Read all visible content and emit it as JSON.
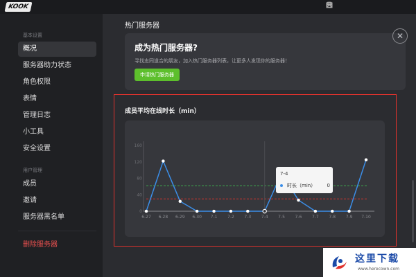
{
  "app": {
    "logo": "KOOK"
  },
  "sidebar": {
    "group1": "基本设置",
    "items1": [
      {
        "label": "概况",
        "active": true
      },
      {
        "label": "服务器助力状态"
      },
      {
        "label": "角色权限"
      },
      {
        "label": "表情"
      },
      {
        "label": "管理日志"
      },
      {
        "label": "小工具"
      },
      {
        "label": "安全设置"
      }
    ],
    "group2": "用户管理",
    "items2": [
      {
        "label": "成员"
      },
      {
        "label": "邀请"
      },
      {
        "label": "服务器黑名单"
      }
    ],
    "delete": "删除服务器"
  },
  "hot": {
    "section_title": "热门服务器",
    "title": "成为热门服务器?",
    "desc": "寻找志同道合的朋友，加入热门服务器列表，让更多人发现你的服务器！",
    "button": "申请热门服务器"
  },
  "chart_data": {
    "type": "line",
    "title": "成员平均在线时长（min）",
    "categories": [
      "6-27",
      "6-28",
      "6-29",
      "6-30",
      "7-1",
      "7-2",
      "7-3",
      "7-4",
      "7-5",
      "7-6",
      "7-7",
      "7-8",
      "7-9",
      "7-10"
    ],
    "series": [
      {
        "name": "时长（min）",
        "values": [
          0,
          122,
          24,
          0,
          0,
          0,
          0,
          0,
          92,
          27,
          0,
          0,
          0,
          125
        ],
        "color": "#3b8ee8"
      }
    ],
    "y_ticks": [
      0,
      40,
      80,
      120,
      160
    ],
    "ylim": [
      0,
      160
    ],
    "reference_lines": [
      {
        "value": 62,
        "color": "#3fb950"
      },
      {
        "value": 30,
        "color": "#e0322d"
      }
    ],
    "tooltip": {
      "date": "7-4",
      "label": "时长（min）",
      "value": "0"
    },
    "grid": false
  },
  "window_icons": [
    "box-icon",
    "shirt-icon",
    "help-icon",
    "minimize-icon",
    "maximize-icon",
    "close-icon"
  ],
  "watermark": {
    "text": "这里下载",
    "url": "www.herecown.com"
  }
}
